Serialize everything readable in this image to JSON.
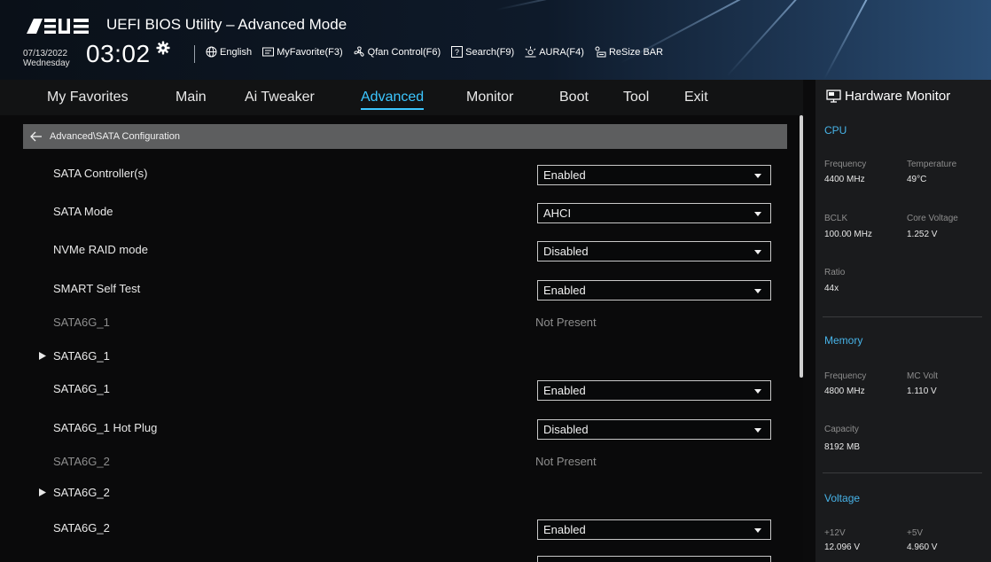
{
  "header": {
    "logo_text": "ASUS",
    "title": "UEFI BIOS Utility – Advanced Mode",
    "date": "07/13/2022",
    "weekday": "Wednesday",
    "time": "03:02",
    "toolbar": [
      {
        "label": "English",
        "icon": "globe-icon"
      },
      {
        "label": "MyFavorite(F3)",
        "icon": "favorite-icon"
      },
      {
        "label": "Qfan Control(F6)",
        "icon": "fan-icon"
      },
      {
        "label": "Search(F9)",
        "icon": "search-icon"
      },
      {
        "label": "AURA(F4)",
        "icon": "aura-icon"
      },
      {
        "label": "ReSize BAR",
        "icon": "resize-bar-icon"
      }
    ]
  },
  "nav": {
    "tabs": [
      "My Favorites",
      "Main",
      "Ai Tweaker",
      "Advanced",
      "Monitor",
      "Boot",
      "Tool",
      "Exit"
    ],
    "active": "Advanced"
  },
  "breadcrumb": "Advanced\\SATA Configuration",
  "rows": [
    {
      "label": "SATA Controller(s)",
      "value": "Enabled"
    },
    {
      "label": "SATA Mode",
      "value": "AHCI"
    },
    {
      "label": "NVMe RAID mode",
      "value": "Disabled"
    },
    {
      "label": "SMART Self Test",
      "value": "Enabled"
    },
    {
      "label": "SATA6G_1",
      "value": "Not Present"
    },
    {
      "label": "SATA6G_1"
    },
    {
      "label": "SATA6G_1",
      "value": "Enabled"
    },
    {
      "label": "SATA6G_1 Hot Plug",
      "value": "Disabled"
    },
    {
      "label": "SATA6G_2",
      "value": "Not Present"
    },
    {
      "label": "SATA6G_2"
    },
    {
      "label": "SATA6G_2",
      "value": "Enabled"
    }
  ],
  "hardware_monitor": {
    "title": "Hardware Monitor",
    "cpu": {
      "heading": "CPU",
      "frequency_label": "Frequency",
      "frequency": "4400 MHz",
      "temperature_label": "Temperature",
      "temperature": "49°C",
      "bclk_label": "BCLK",
      "bclk": "100.00 MHz",
      "core_voltage_label": "Core Voltage",
      "core_voltage": "1.252 V",
      "ratio_label": "Ratio",
      "ratio": "44x"
    },
    "memory": {
      "heading": "Memory",
      "frequency_label": "Frequency",
      "frequency": "4800 MHz",
      "mc_volt_label": "MC Volt",
      "mc_volt": "1.110 V",
      "capacity_label": "Capacity",
      "capacity": "8192 MB"
    },
    "voltage": {
      "heading": "Voltage",
      "v12_label": "+12V",
      "v12": "12.096 V",
      "v5_label": "+5V",
      "v5": "4.960 V"
    }
  },
  "colors": {
    "accent": "#3cc6ff",
    "section_heading": "#47b3e8",
    "breadcrumb_bg": "#5d5e5f",
    "panel_bg": "#1a1b1d"
  }
}
